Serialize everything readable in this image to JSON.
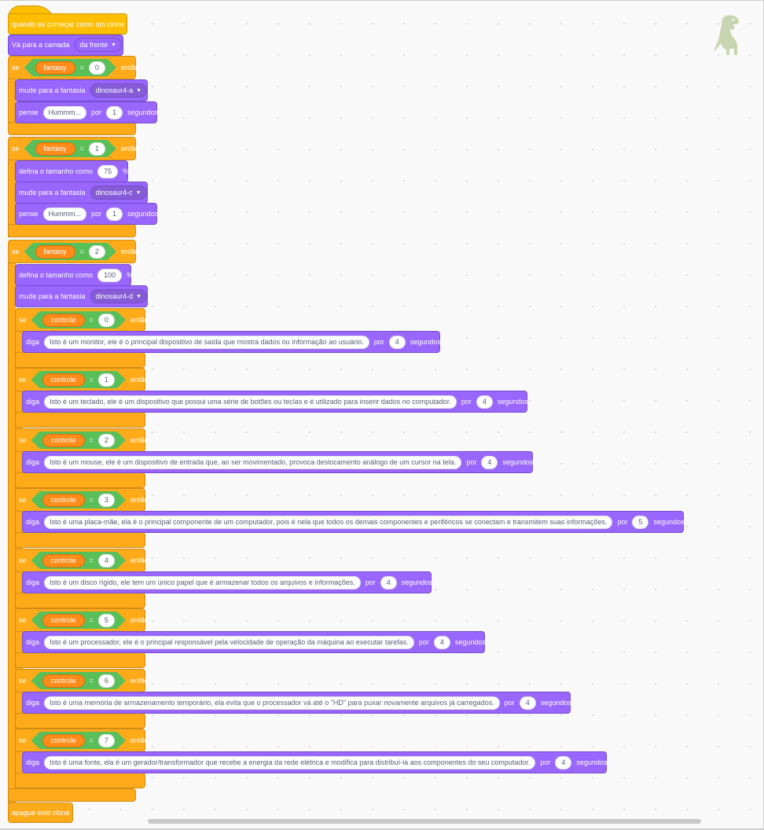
{
  "hat": {
    "label": "quando eu começar como um clone"
  },
  "layer": {
    "prefix": "Vá para a camada",
    "option": "da frente"
  },
  "if1": {
    "se": "se",
    "var": "fantasy",
    "op": "=",
    "value": "0",
    "entao": "então",
    "costume": {
      "label": "mude para a fantasia",
      "option": "dinosaur4-a"
    },
    "think": {
      "label": "pense",
      "text": "Hummm...",
      "por": "por",
      "secs": "1",
      "unit": "segundos"
    }
  },
  "if2": {
    "se": "se",
    "var": "fantasy",
    "op": "=",
    "value": "1",
    "entao": "então",
    "size": {
      "label": "defina o tamanho como",
      "value": "75",
      "unit": "%"
    },
    "costume": {
      "label": "mude para a fantasia",
      "option": "dinosaur4-c"
    },
    "think": {
      "label": "pense",
      "text": "Hummm...",
      "por": "por",
      "secs": "1",
      "unit": "segundos"
    }
  },
  "if3": {
    "se": "se",
    "var": "fantasy",
    "op": "=",
    "value": "2",
    "entao": "então",
    "size": {
      "label": "defina o tamanho como",
      "value": "100",
      "unit": "%"
    },
    "costume": {
      "label": "mude para a fantasia",
      "option": "dinosaur4-d"
    }
  },
  "inner_ifs": [
    {
      "se": "se",
      "var": "controle",
      "op": "=",
      "value": "0",
      "entao": "então",
      "say": "diga",
      "text": "Isto é um monitor, ele é o principal dispositivo de saída que mostra dados ou informação ao usuário.",
      "por": "por",
      "secs": "4",
      "unit": "segundos"
    },
    {
      "se": "se",
      "var": "controle",
      "op": "=",
      "value": "1",
      "entao": "então",
      "say": "diga",
      "text": "Isto é um teclado, ele é um dispositivo que possui uma série de botões ou teclas e é utilizado para inserir dados no computador.",
      "por": "por",
      "secs": "4",
      "unit": "segundos"
    },
    {
      "se": "se",
      "var": "controle",
      "op": "=",
      "value": "2",
      "entao": "então",
      "say": "diga",
      "text": "Isto é um mouse, ele é um dispositivo de entrada que, ao ser movimentado, provoca deslocamento análogo de um cursor na tela.",
      "por": "por",
      "secs": "4",
      "unit": "segundos"
    },
    {
      "se": "se",
      "var": "controle",
      "op": "=",
      "value": "3",
      "entao": "então",
      "say": "diga",
      "text": "Isto é uma placa-mãe, ela é o principal componente de um computador, pois é nela que todos os demais componentes e periféricos se conectam e transmitem suas informações.",
      "por": "por",
      "secs": "5",
      "unit": "segundos"
    },
    {
      "se": "se",
      "var": "controle",
      "op": "=",
      "value": "4",
      "entao": "então",
      "say": "diga",
      "text": "Isto é um disco rígido, ele tem um único papel que é armazenar todos os arquivos e informações.",
      "por": "por",
      "secs": "4",
      "unit": "segundos"
    },
    {
      "se": "se",
      "var": "controle",
      "op": "=",
      "value": "5",
      "entao": "então",
      "say": "diga",
      "text": "Isto é um processador, ele é o principal responsável pela velocidade de operação da máquina ao executar tarefas.",
      "por": "por",
      "secs": "4",
      "unit": "segundos"
    },
    {
      "se": "se",
      "var": "controle",
      "op": "=",
      "value": "6",
      "entao": "então",
      "say": "diga",
      "text": "Isto é uma memória de armazenamento temporário, ela evita que o processador vá até o \"HD\" para puxar novamente arquivos já carregados.",
      "por": "por",
      "secs": "4",
      "unit": "segundos"
    },
    {
      "se": "se",
      "var": "controle",
      "op": "=",
      "value": "7",
      "entao": "então",
      "say": "diga",
      "text": "Isto é uma fonte, ela é um gerador/transformador que recebe a energia da rede elétrica e modifica para distribuí-la aos componentes do seu computador.",
      "por": "por",
      "secs": "4",
      "unit": "segundos"
    }
  ],
  "end": {
    "label": "apague este clone"
  },
  "sprite_icon": "dinosaur-sprite-icon",
  "colors": {
    "events": "#ffbf00",
    "control": "#ffab19",
    "looks": "#9966ff",
    "operators": "#59c059",
    "variables": "#ff8c1a"
  }
}
